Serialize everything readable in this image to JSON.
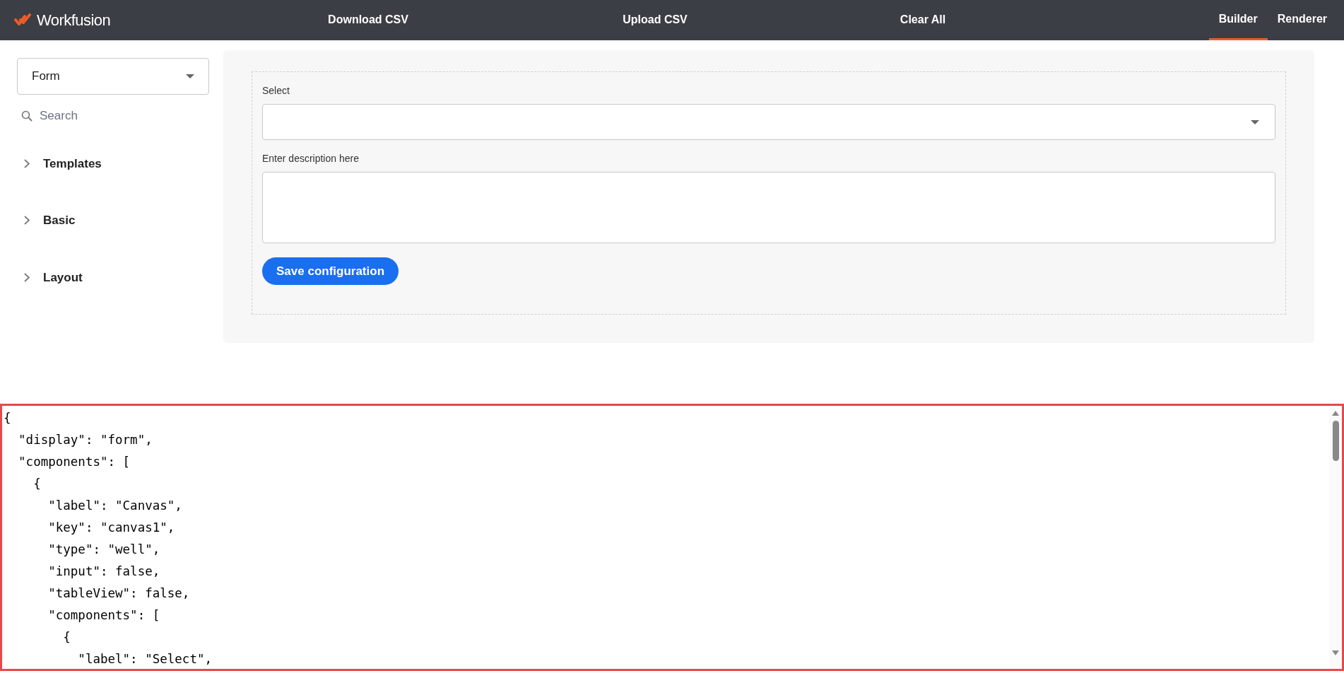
{
  "header": {
    "logo_text": "Workfusion",
    "actions": [
      {
        "label": "Download CSV"
      },
      {
        "label": "Upload CSV"
      },
      {
        "label": "Clear All"
      }
    ],
    "tabs": [
      {
        "label": "Builder",
        "selected": true
      },
      {
        "label": "Renderer",
        "selected": false
      }
    ]
  },
  "sidebar": {
    "dropdown": {
      "value": "Form"
    },
    "search": {
      "placeholder": "Search"
    },
    "groups": [
      {
        "label": "Templates",
        "expanded": false
      },
      {
        "label": "Basic",
        "expanded": false
      },
      {
        "label": "Layout",
        "expanded": false
      }
    ]
  },
  "form": {
    "fields": [
      {
        "kind": "select",
        "label": "Select"
      },
      {
        "kind": "textarea",
        "label": "Enter description here"
      }
    ],
    "button": "Save configuration"
  },
  "code_editor": {
    "lines": [
      "{",
      "  \"display\": \"form\",",
      "  \"components\": [",
      "    {",
      "      \"label\": \"Canvas\",",
      "      \"key\": \"canvas1\",",
      "      \"type\": \"well\",",
      "      \"input\": false,",
      "      \"tableView\": false,",
      "      \"components\": [",
      "        {",
      "          \"label\": \"Select\","
    ]
  }
}
